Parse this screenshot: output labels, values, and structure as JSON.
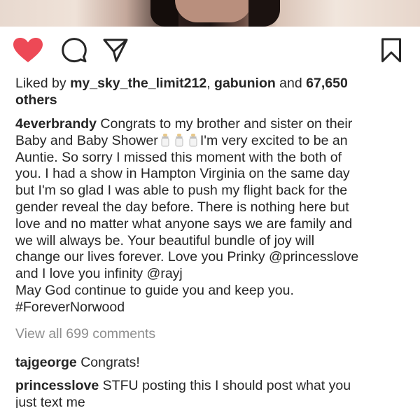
{
  "post": {
    "likes_prefix": "Liked by ",
    "liker1": "my_sky_the_limit212",
    "likes_sep": ", ",
    "liker2": "gabunion",
    "likes_and": " and ",
    "likes_count": "67,650",
    "likes_suffix": "others",
    "author": "4everbrandy",
    "caption_lines": [
      " Congrats to my brother and sister on their",
      "Baby and Baby Shower",
      "I'm very excited to be an",
      "Auntie. So sorry I missed this moment with the both of",
      "you. I had a show in Hampton Virginia on the same day",
      "but I'm so glad I was able to push my flight back for the",
      "gender reveal the day before. There is nothing here but",
      "love and no matter what anyone says we are family and",
      "we will always be. Your beautiful bundle of joy will",
      "change our lives forever. Love you Prinky @princesslove",
      "and I love you infinity @rayj",
      "May God continue to guide you and keep you.",
      "#ForeverNorwood"
    ],
    "view_all_comments": "View all 699 comments"
  },
  "comments": [
    {
      "user": "tajgeorge",
      "text": " Congrats!"
    },
    {
      "user": "princesslove",
      "text": " STFU posting this I should post what you",
      "text2": "just text me"
    }
  ],
  "icons": {
    "like": "heart-icon",
    "comment": "comment-icon",
    "share": "paper-plane-icon",
    "save": "bookmark-icon"
  },
  "colors": {
    "heart": "#ed4956",
    "text": "#262626",
    "muted": "#8e8e8e"
  }
}
